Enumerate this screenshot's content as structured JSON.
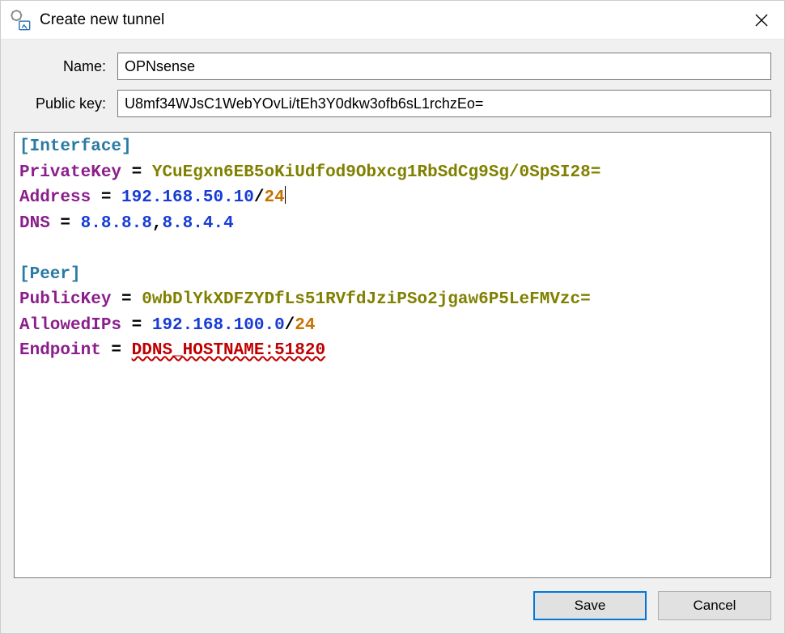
{
  "window": {
    "title": "Create new tunnel"
  },
  "form": {
    "name_label": "Name:",
    "name_value": "OPNsense",
    "pubkey_label": "Public key:",
    "pubkey_value": "U8mf34WJsC1WebYOvLi/tEh3Y0dkw3ofb6sL1rchzEo="
  },
  "config": {
    "interface_header": "[Interface]",
    "private_key_label": "PrivateKey",
    "private_key_value": "YCuEgxn6EB5oKiUdfod9Obxcg1RbSdCg9Sg/0SpSI28=",
    "address_label": "Address",
    "address_ip": "192.168.50.10",
    "address_mask": "24",
    "dns_label": "DNS",
    "dns1": "8.8.8.8",
    "dns2": "8.8.4.4",
    "peer_header": "[Peer]",
    "peer_pubkey_label": "PublicKey",
    "peer_pubkey_value": "0wbDlYkXDFZYDfLs51RVfdJziPSo2jgaw6P5LeFMVzc=",
    "allowed_label": "AllowedIPs",
    "allowed_ip": "192.168.100.0",
    "allowed_mask": "24",
    "endpoint_label": "Endpoint",
    "endpoint_value": "DDNS_HOSTNAME:51820"
  },
  "buttons": {
    "save": "Save",
    "cancel": "Cancel"
  }
}
